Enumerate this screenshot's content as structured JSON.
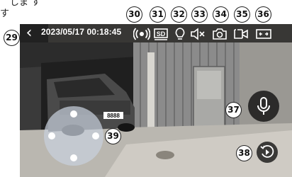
{
  "doc_text": {
    "line1": "しま す",
    "line2": "す"
  },
  "video": {
    "timestamp": "2023/05/17 00:18:45",
    "plate_text": "8888"
  },
  "toolbar": {
    "icons": [
      "wifi-signal-icon",
      "sd-card-icon",
      "light-bulb-icon",
      "speaker-muted-icon",
      "camera-icon",
      "record-video-icon",
      "fullscreen-icon"
    ],
    "sd_label": "SD"
  },
  "callouts": {
    "c29": "29",
    "c30": "30",
    "c31": "31",
    "c32": "32",
    "c33": "33",
    "c34": "34",
    "c35": "35",
    "c36": "36",
    "c37": "37",
    "c38": "38",
    "c39": "39"
  }
}
